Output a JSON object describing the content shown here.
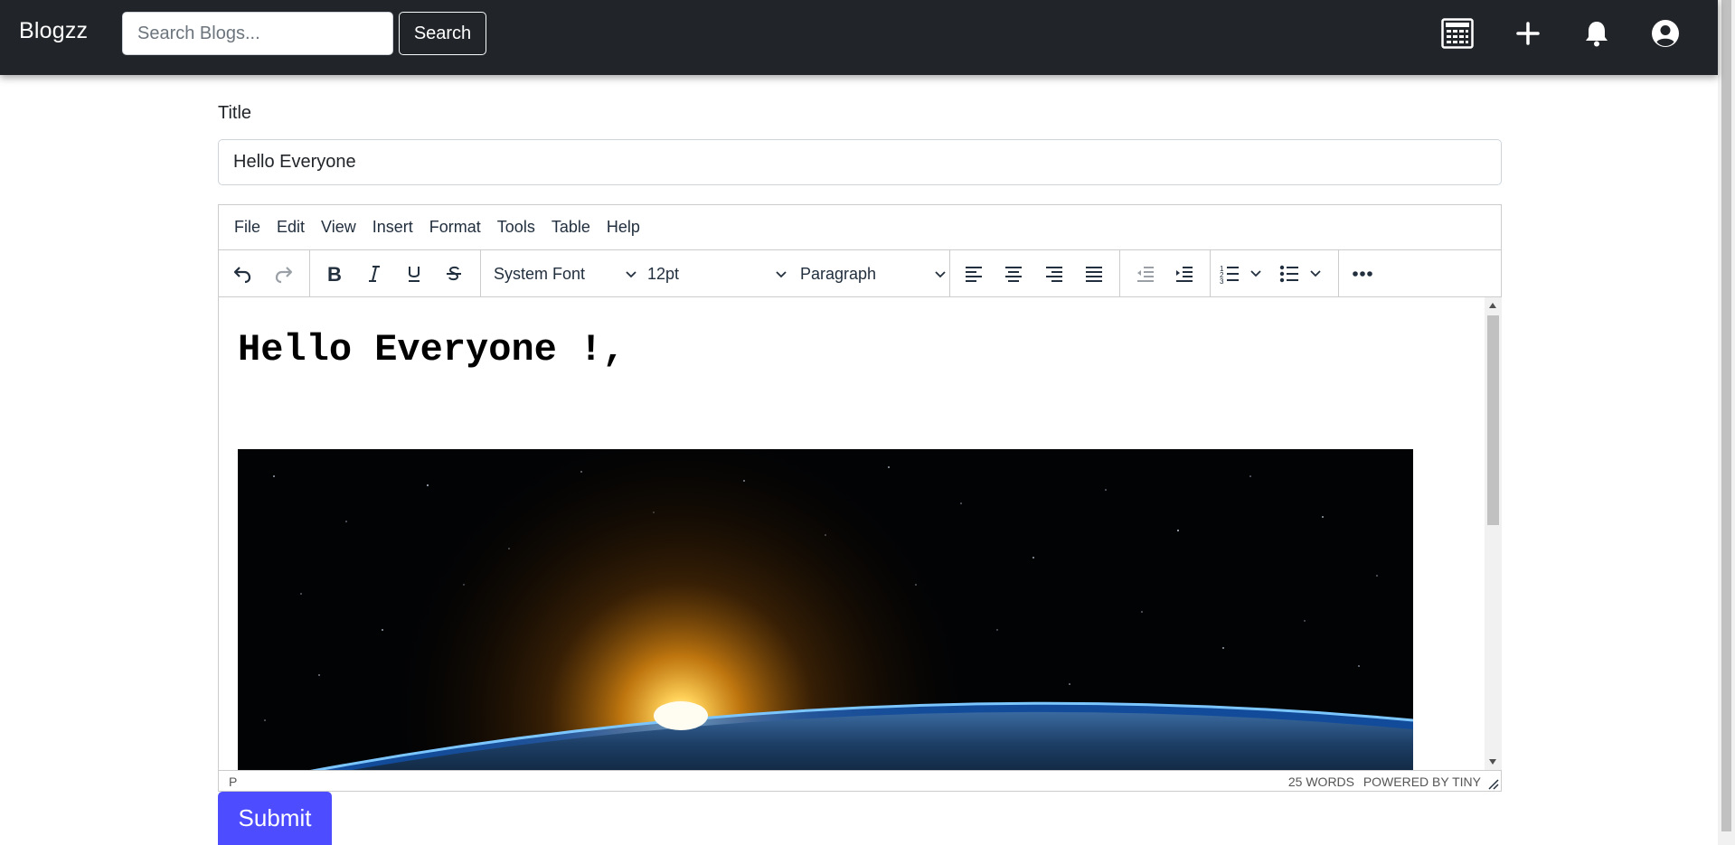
{
  "navbar": {
    "brand": "Blogzz",
    "search_placeholder": "Search Blogs...",
    "search_label": "Search",
    "icons": [
      "calculator-icon",
      "plus-icon",
      "bell-icon",
      "user-circle-icon"
    ]
  },
  "form": {
    "title_label": "Title",
    "title_value": "Hello Everyone",
    "submit_label": "Submit"
  },
  "editor": {
    "menu": [
      "File",
      "Edit",
      "View",
      "Insert",
      "Format",
      "Tools",
      "Table",
      "Help"
    ],
    "toolbar": {
      "font_family": "System Font",
      "font_size": "12pt",
      "block_format": "Paragraph",
      "buttons": [
        "undo-icon",
        "redo-icon",
        "bold-icon",
        "italic-icon",
        "underline-icon",
        "strikethrough-icon",
        "align-left-icon",
        "align-center-icon",
        "align-right-icon",
        "align-justify-icon",
        "outdent-icon",
        "indent-icon",
        "numbered-list-icon",
        "bullet-list-icon",
        "more-icon"
      ]
    },
    "content_heading": "Hello Everyone !,",
    "content_image": "earth-sunrise-from-space",
    "status_path": "P",
    "word_count": "25 WORDS",
    "powered_by": "POWERED BY TINY"
  },
  "colors": {
    "navbar_bg": "#212529",
    "submit_bg": "#4d4dff",
    "toolbar_icon": "#222f3e"
  }
}
